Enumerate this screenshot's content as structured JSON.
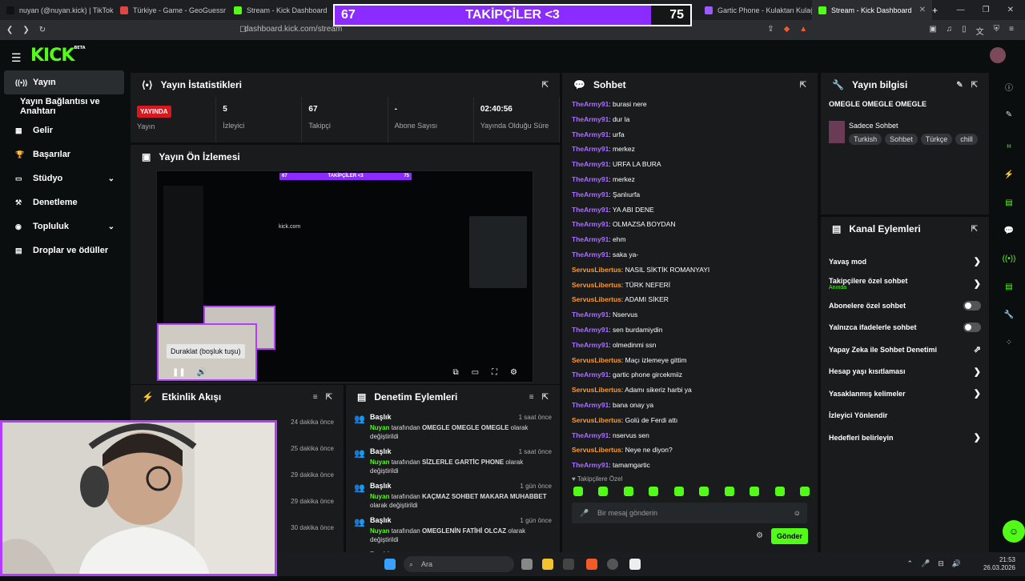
{
  "browser": {
    "tabs": [
      {
        "label": "nuyan (@nuyan.kick) | TikTok",
        "color": "#111111"
      },
      {
        "label": "Türkiye - Game - GeoGuessr",
        "color": "#e04545"
      },
      {
        "label": "Stream - Kick Dashboard",
        "color": "#53fc18"
      },
      {
        "label": "Gartic Phone - Kulaktan Kulağa",
        "color": "#9b59ff"
      },
      {
        "label": "Stream - Kick Dashboard",
        "color": "#53fc18"
      }
    ],
    "url": "dashboard.kick.com/stream"
  },
  "overlay": {
    "left_value": "67",
    "title": "TAKİPÇİLER <3",
    "right_value": "75",
    "fill_fraction": 0.89,
    "fill_color": "#8b2bff"
  },
  "kick": {
    "logo": "KICK",
    "beta": "BETA"
  },
  "sidebar": [
    {
      "label": "Yayın",
      "icon": "broadcast-icon",
      "glyph": "((•))"
    },
    {
      "label": "Yayın Bağlantısı ve Anahtarı",
      "icon": "",
      "glyph": ""
    },
    {
      "label": "Gelir",
      "icon": "revenue-icon",
      "glyph": "▦"
    },
    {
      "label": "Başarılar",
      "icon": "trophy-icon",
      "glyph": "🏆"
    },
    {
      "label": "Stüdyo",
      "icon": "studio-icon",
      "glyph": "▭",
      "chev": "⌄"
    },
    {
      "label": "Denetleme",
      "icon": "hammer-icon",
      "glyph": "⚒"
    },
    {
      "label": "Topluluk",
      "icon": "community-icon",
      "glyph": "◉",
      "chev": "⌄"
    },
    {
      "label": "Droplar ve ödüller",
      "icon": "drops-icon",
      "glyph": "▤"
    }
  ],
  "stats_panel": {
    "title": "Yayın İstatistikleri",
    "live_badge": "YAYINDA",
    "items": [
      {
        "value": "",
        "label": "Yayın"
      },
      {
        "value": "5",
        "label": "İzleyici"
      },
      {
        "value": "67",
        "label": "Takipçi"
      },
      {
        "value": "-",
        "label": "Abone Sayısı"
      },
      {
        "value": "02:40:56",
        "label": "Yayında Olduğu Süre"
      }
    ]
  },
  "preview": {
    "title": "Yayın Ön İzlemesi",
    "tooltip": "Duraklat (boşluk tuşu)",
    "nested_title": "TAKİPÇİLER <3",
    "nested_left": "67",
    "nested_right": "75",
    "nested_site": "kick.com"
  },
  "activity": {
    "title": "Etkinlik Akışı",
    "times": [
      "24 dakika önce",
      "25 dakika önce",
      "29 dakika önce",
      "29 dakika önce",
      "30 dakika önce"
    ]
  },
  "moderation": {
    "title": "Denetim Eylemleri",
    "items": [
      {
        "title": "Başlık",
        "time": "1 saat önce",
        "user": "Nuyan",
        "by": "tarafından",
        "value": "OMEGLE OMEGLE OMEGLE",
        "suffix": "olarak değiştirildi"
      },
      {
        "title": "Başlık",
        "time": "1 saat önce",
        "user": "Nuyan",
        "by": "tarafından",
        "value": "SİZLERLE GARTİC PHONE",
        "suffix": "olarak değiştirildi"
      },
      {
        "title": "Başlık",
        "time": "1 gün önce",
        "user": "Nuyan",
        "by": "tarafından",
        "value": "KAÇMAZ SOHBET MAKARA MUHABBET",
        "suffix": "olarak değiştirildi"
      },
      {
        "title": "Başlık",
        "time": "1 gün önce",
        "user": "Nuyan",
        "by": "tarafından",
        "value": "OMEGLENİN FATİHİ OLCAZ",
        "suffix": "olarak değiştirildi"
      },
      {
        "title": "Başlık",
        "time": "1 gün önce",
        "user": "",
        "by": "",
        "value": "",
        "suffix": ""
      }
    ]
  },
  "chat": {
    "title": "Sohbet",
    "colors": {
      "TheArmy91": "#a970ff",
      "ServusLibertus": "#ff9a2e"
    },
    "messages": [
      {
        "user": "TheArmy91",
        "text": "burasi nere"
      },
      {
        "user": "TheArmy91",
        "text": "dur la"
      },
      {
        "user": "TheArmy91",
        "text": "urfa"
      },
      {
        "user": "TheArmy91",
        "text": "merkez"
      },
      {
        "user": "TheArmy91",
        "text": "URFA LA BURA"
      },
      {
        "user": "TheArmy91",
        "text": "merkez"
      },
      {
        "user": "TheArmy91",
        "text": "Şanlıurfa"
      },
      {
        "user": "TheArmy91",
        "text": "YA ABI DENE"
      },
      {
        "user": "TheArmy91",
        "text": "OLMAZSA BOYDAN"
      },
      {
        "user": "TheArmy91",
        "text": "ehm"
      },
      {
        "user": "TheArmy91",
        "text": "saka ya-"
      },
      {
        "user": "ServusLibertus",
        "text": "NASIL SİKTİK ROMANYAYI"
      },
      {
        "user": "ServusLibertus",
        "text": "TÜRK NEFERİ"
      },
      {
        "user": "ServusLibertus",
        "text": "ADAMI SİKER"
      },
      {
        "user": "TheArmy91",
        "text": "Nservus"
      },
      {
        "user": "TheArmy91",
        "text": "sen burdamiydin"
      },
      {
        "user": "TheArmy91",
        "text": "olmedinmi ssn"
      },
      {
        "user": "ServusLibertus",
        "text": "Maçı izlemeye gittim"
      },
      {
        "user": "TheArmy91",
        "text": "gartic phone gircekmiiz"
      },
      {
        "user": "ServusLibertus",
        "text": "Adamı sikeriz harbi ya"
      },
      {
        "user": "TheArmy91",
        "text": "bana onay ya"
      },
      {
        "user": "ServusLibertus",
        "text": "Golü de Ferdi attı"
      },
      {
        "user": "TheArmy91",
        "text": "nservus sen"
      },
      {
        "user": "ServusLibertus",
        "text": "Neye ne diyon?"
      },
      {
        "user": "TheArmy91",
        "text": "tamamgartic"
      }
    ],
    "followers_only": "Takipçilere Özel",
    "placeholder": "Bir mesaj gönderin",
    "send": "Gönder"
  },
  "stream_info": {
    "title": "Yayın bilgisi",
    "stream_title": "OMEGLE OMEGLE OMEGLE",
    "category": "Sadece Sohbet",
    "tags": [
      "Turkish",
      "Sohbet",
      "Türkçe",
      "chill"
    ]
  },
  "channel_actions": {
    "title": "Kanal Eylemleri",
    "items": [
      {
        "label": "Yavaş mod",
        "control": "chevron"
      },
      {
        "label": "Takipçilere özel sohbet",
        "sub": "Anında",
        "control": "chevron"
      },
      {
        "label": "Abonelere özel sohbet",
        "control": "toggle"
      },
      {
        "label": "Yalnızca ifadelerle sohbet",
        "control": "toggle"
      },
      {
        "label": "Yapay Zeka ile Sohbet Denetimi",
        "control": "external"
      },
      {
        "label": "Hesap yaşı kısıtlaması",
        "control": "chevron"
      },
      {
        "label": "Yasaklanmış kelimeler",
        "control": "chevron"
      },
      {
        "label": "İzleyici Yönlendir",
        "control": "none"
      },
      {
        "label": "Hedefleri belirleyin",
        "control": "chevron"
      }
    ]
  },
  "taskbar": {
    "search": "Ara",
    "time": "21:53",
    "date": "26.03.2026"
  }
}
